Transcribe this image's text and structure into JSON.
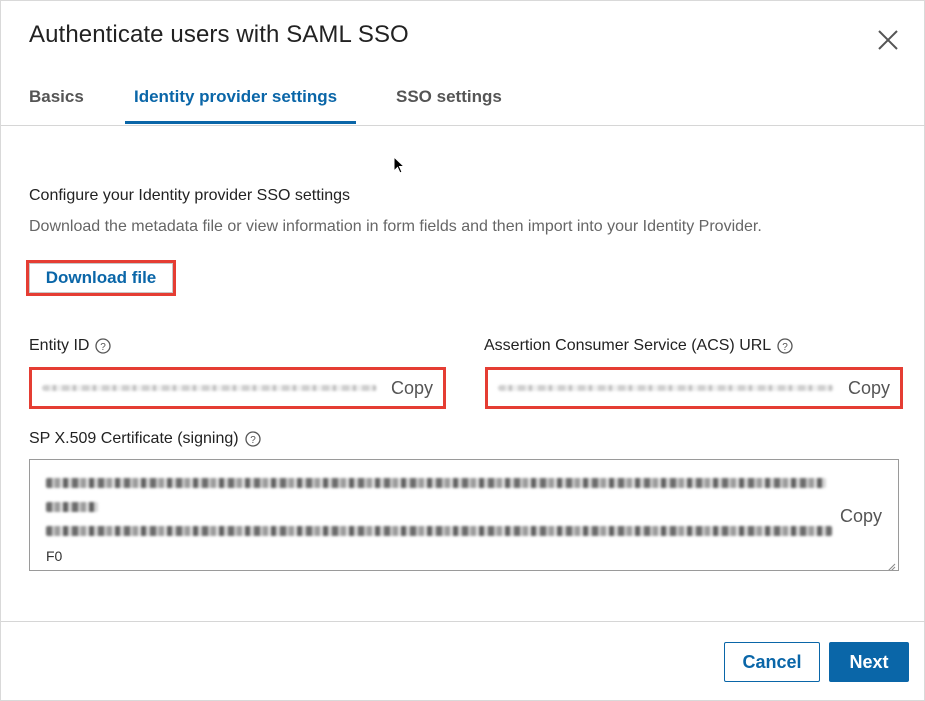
{
  "dialog": {
    "title": "Authenticate users with SAML SSO",
    "close_icon": "close-icon"
  },
  "tabs": [
    {
      "label": "Basics",
      "active": false
    },
    {
      "label": "Identity provider settings",
      "active": true
    },
    {
      "label": "SSO settings",
      "active": false
    }
  ],
  "section": {
    "title": "Configure your Identity provider SSO settings",
    "description": "Download the metadata file or view information in form fields and then import into your Identity Provider.",
    "download_label": "Download file"
  },
  "fields": {
    "entity_id": {
      "label": "Entity ID",
      "copy_label": "Copy",
      "help_icon": "help-icon"
    },
    "acs_url": {
      "label": "Assertion Consumer Service (ACS) URL",
      "copy_label": "Copy",
      "help_icon": "help-icon"
    },
    "certificate": {
      "label": "SP X.509 Certificate (signing)",
      "copy_label": "Copy",
      "tail_text": "F0",
      "help_icon": "help-icon"
    }
  },
  "footer": {
    "cancel_label": "Cancel",
    "next_label": "Next"
  },
  "colors": {
    "accent": "#0a66a8",
    "highlight": "#e53d33"
  }
}
